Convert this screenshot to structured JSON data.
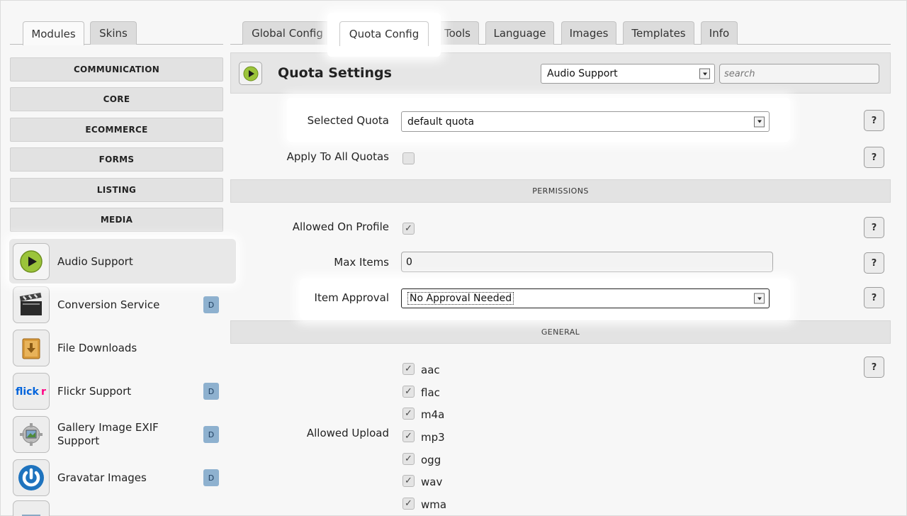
{
  "top_tabs_left": [
    {
      "label": "Modules",
      "name": "tab-modules"
    },
    {
      "label": "Skins",
      "name": "tab-skins"
    }
  ],
  "top_tabs_right": [
    {
      "label": "Global Config",
      "name": "tab-global-config"
    },
    {
      "label": "Quota Config",
      "name": "tab-quota-config"
    },
    {
      "label": "Tools",
      "name": "tab-tools"
    },
    {
      "label": "Language",
      "name": "tab-language"
    },
    {
      "label": "Images",
      "name": "tab-images"
    },
    {
      "label": "Templates",
      "name": "tab-templates"
    },
    {
      "label": "Info",
      "name": "tab-info"
    }
  ],
  "sidebar": {
    "categories": [
      "COMMUNICATION",
      "CORE",
      "ECOMMERCE",
      "FORMS",
      "LISTING",
      "MEDIA"
    ],
    "modules": [
      {
        "label": "Audio Support",
        "icon": "play-icon",
        "badge": ""
      },
      {
        "label": "Conversion Service",
        "icon": "clapperboard-icon",
        "badge": "D"
      },
      {
        "label": "File Downloads",
        "icon": "download-box-icon",
        "badge": ""
      },
      {
        "label": "Flickr Support",
        "icon": "flickr-logo-icon",
        "badge": "D"
      },
      {
        "label": "Gallery Image EXIF Support",
        "icon": "gear-image-icon",
        "badge": "D"
      },
      {
        "label": "Gravatar Images",
        "icon": "power-circle-icon",
        "badge": "D"
      }
    ]
  },
  "panel": {
    "title": "Quota Settings",
    "module_select": "Audio Support",
    "search_placeholder": "search",
    "help_label": "?"
  },
  "form": {
    "selected_quota_label": "Selected Quota",
    "selected_quota_value": "default quota",
    "apply_all_label": "Apply To All Quotas",
    "apply_all_checked": false,
    "permissions_header": "PERMISSIONS",
    "allowed_on_profile_label": "Allowed On Profile",
    "allowed_on_profile_checked": true,
    "max_items_label": "Max Items",
    "max_items_value": "0",
    "item_approval_label": "Item Approval",
    "item_approval_value": "No Approval Needed",
    "general_header": "GENERAL",
    "allowed_upload_label": "Allowed Upload",
    "allowed_upload": [
      "aac",
      "flac",
      "m4a",
      "mp3",
      "ogg",
      "wav",
      "wma"
    ]
  },
  "colors": {
    "badge": "#8eb1cf",
    "play_green": "#9bc43a"
  }
}
